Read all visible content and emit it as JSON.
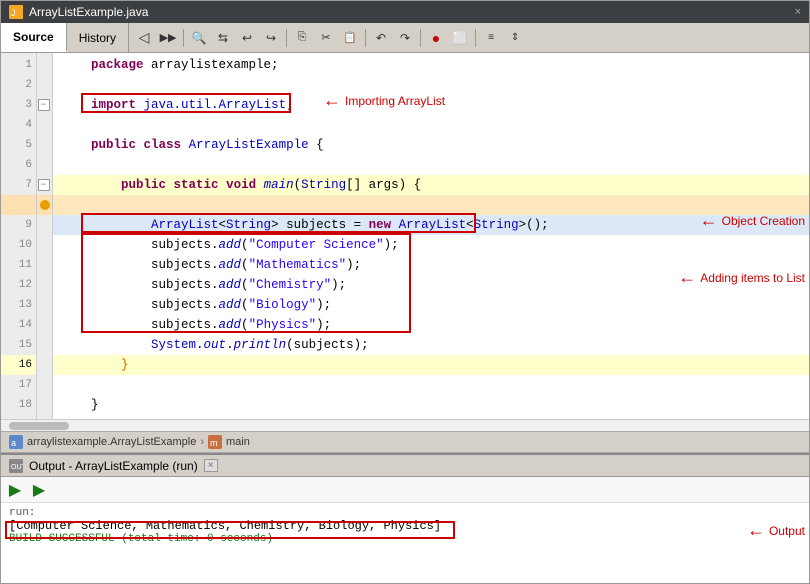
{
  "titlebar": {
    "filename": "ArrayListExample.java",
    "close_label": "×"
  },
  "tabs": {
    "source_label": "Source",
    "history_label": "History"
  },
  "toolbar": {
    "buttons": [
      "◁",
      "▷▷",
      "◉",
      "⬜",
      "≡≡"
    ]
  },
  "line_numbers": [
    1,
    2,
    3,
    4,
    5,
    6,
    7,
    8,
    9,
    10,
    11,
    12,
    13,
    14,
    15,
    16,
    17,
    18
  ],
  "code_lines": [
    {
      "num": 1,
      "text": "    package arraylistexample;",
      "highlight": false
    },
    {
      "num": 2,
      "text": "",
      "highlight": false
    },
    {
      "num": 3,
      "text": "    import java.util.ArrayList;",
      "highlight": false,
      "has_collapse": true
    },
    {
      "num": 4,
      "text": "",
      "highlight": false
    },
    {
      "num": 5,
      "text": "    public class ArrayListExample {",
      "highlight": false
    },
    {
      "num": 6,
      "text": "",
      "highlight": false
    },
    {
      "num": 7,
      "text": "        public static void main(String[] args) {",
      "highlight": true,
      "has_collapse": true
    },
    {
      "num": 8,
      "text": "",
      "highlight": false,
      "has_gutter": true
    },
    {
      "num": 9,
      "text": "            ArrayList<String> subjects = new ArrayList<String>();",
      "highlight": false,
      "blue_bg": true
    },
    {
      "num": 10,
      "text": "            subjects.add(\"Computer Science\");",
      "highlight": false
    },
    {
      "num": 11,
      "text": "            subjects.add(\"Mathematics\");",
      "highlight": false
    },
    {
      "num": 12,
      "text": "            subjects.add(\"Chemistry\");",
      "highlight": false
    },
    {
      "num": 13,
      "text": "            subjects.add(\"Biology\");",
      "highlight": false
    },
    {
      "num": 14,
      "text": "            subjects.add(\"Physics\");",
      "highlight": false
    },
    {
      "num": 15,
      "text": "            System.out.println(subjects);",
      "highlight": false
    },
    {
      "num": 16,
      "text": "        }",
      "highlight": true
    },
    {
      "num": 17,
      "text": "",
      "highlight": false
    },
    {
      "num": 18,
      "text": "    }",
      "highlight": false
    }
  ],
  "annotations": {
    "import_label": "Importing ArrayList",
    "object_label": "Object Creation",
    "adding_label": "Adding items to List",
    "output_label": "Output"
  },
  "breadcrumb": {
    "package": "arraylistexample.ArrayListExample",
    "method": "main"
  },
  "output_panel": {
    "title": "Output - ArrayListExample (run)",
    "close_label": "×",
    "run_label": "run:",
    "output_line": "[Computer Science, Mathematics, Chemistry, Biology, Physics]",
    "success_line": "BUILD SUCCESSFUL  (total time: 0 seconds)"
  }
}
